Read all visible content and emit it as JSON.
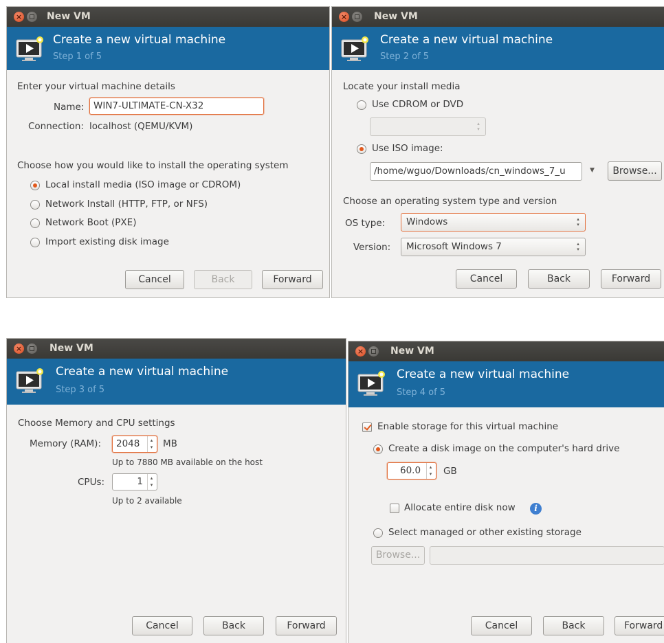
{
  "dialogs": [
    {
      "window_title": "New VM",
      "header_title": "Create a new virtual machine",
      "step": "Step 1 of 5",
      "details_heading": "Enter your virtual machine details",
      "name_label": "Name:",
      "name_value": "WIN7-ULTIMATE-CN-X32",
      "connection_label": "Connection:",
      "connection_value": "localhost (QEMU/KVM)",
      "install_heading": "Choose how you would like to install the operating system",
      "install_options": [
        {
          "label": "Local install media (ISO image or CDROM)",
          "selected": true
        },
        {
          "label": "Network Install (HTTP, FTP, or NFS)",
          "selected": false
        },
        {
          "label": "Network Boot (PXE)",
          "selected": false
        },
        {
          "label": "Import existing disk image",
          "selected": false
        }
      ],
      "buttons": {
        "cancel": "Cancel",
        "back": "Back",
        "forward": "Forward"
      },
      "back_enabled": false
    },
    {
      "window_title": "New VM",
      "header_title": "Create a new virtual machine",
      "step": "Step 2 of 5",
      "media_heading": "Locate your install media",
      "cdrom_label": "Use CDROM or DVD",
      "cdrom_selected": false,
      "iso_label": "Use ISO image:",
      "iso_selected": true,
      "iso_path": "/home/wguo/Downloads/cn_windows_7_u",
      "browse_label": "Browse...",
      "os_heading": "Choose an operating system type and version",
      "os_type_label": "OS type:",
      "os_type_value": "Windows",
      "version_label": "Version:",
      "version_value": "Microsoft Windows 7",
      "buttons": {
        "cancel": "Cancel",
        "back": "Back",
        "forward": "Forward"
      }
    },
    {
      "window_title": "New VM",
      "header_title": "Create a new virtual machine",
      "step": "Step 3 of 5",
      "settings_heading": "Choose Memory and CPU settings",
      "memory_label": "Memory (RAM):",
      "memory_value": "2048",
      "memory_unit": "MB",
      "memory_hint": "Up to 7880 MB available on the host",
      "cpus_label": "CPUs:",
      "cpus_value": "1",
      "cpus_hint": "Up to 2 available",
      "buttons": {
        "cancel": "Cancel",
        "back": "Back",
        "forward": "Forward"
      }
    },
    {
      "window_title": "New VM",
      "header_title": "Create a new virtual machine",
      "step": "Step 4 of 5",
      "enable_storage_label": "Enable storage for this virtual machine",
      "enable_storage_checked": true,
      "create_disk_label": "Create a disk image on the computer's hard drive",
      "create_disk_selected": true,
      "disk_size_value": "60.0",
      "disk_size_unit": "GB",
      "allocate_label": "Allocate entire disk now",
      "allocate_checked": false,
      "managed_label": "Select managed or other existing storage",
      "managed_selected": false,
      "browse_label": "Browse...",
      "buttons": {
        "cancel": "Cancel",
        "back": "Back",
        "forward": "Forward"
      }
    }
  ],
  "colors": {
    "header_bg": "#1a69a0",
    "accent_orange": "#e2591c",
    "titlebar_bg": "#3f3e3a",
    "dialog_bg": "#f2f1f0"
  }
}
